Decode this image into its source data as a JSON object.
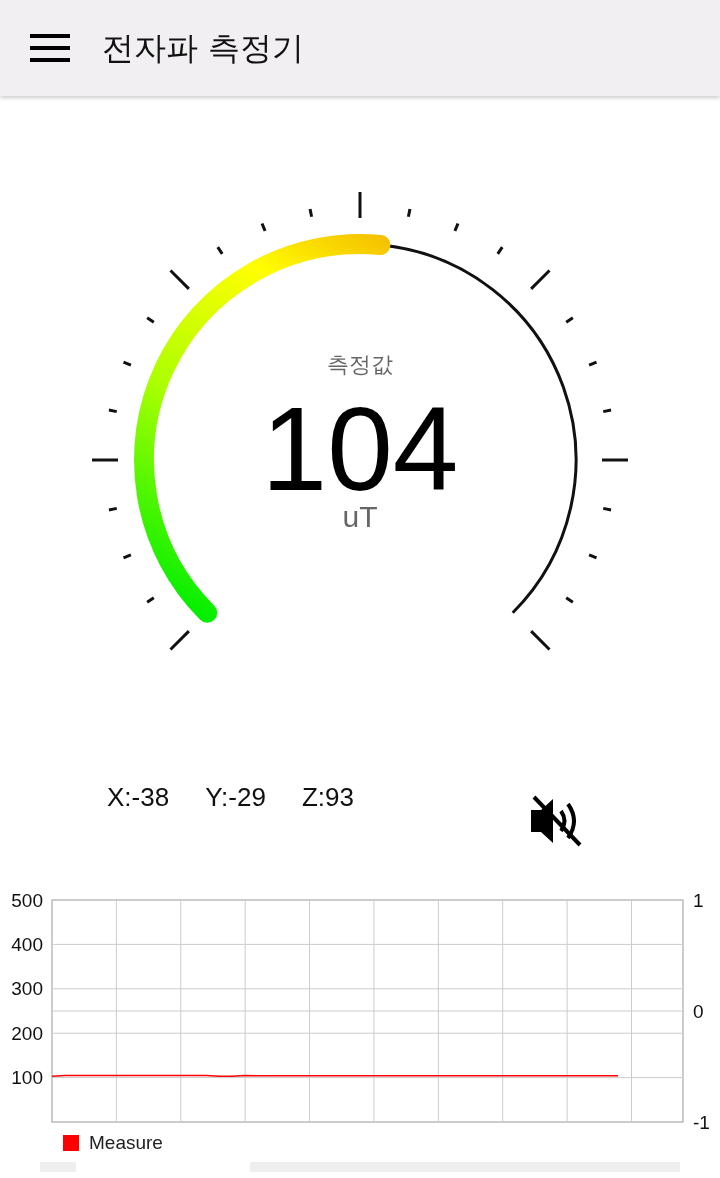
{
  "app_bar": {
    "title": "전자파 측정기"
  },
  "gauge": {
    "label": "측정값",
    "reading": "104",
    "unit": "uT"
  },
  "axes_readings": [
    "X:-38",
    "Y:-29",
    "Z:93"
  ],
  "sound": {
    "muted": true
  },
  "chart": {
    "right_axis_labels": [
      "1",
      "0",
      "-1"
    ],
    "chart_data": {
      "type": "line",
      "categories": [
        null,
        null,
        null,
        null,
        null,
        null,
        null,
        null,
        null,
        null,
        null,
        null,
        null,
        null,
        null,
        null,
        null,
        null,
        null,
        null,
        null,
        null,
        null,
        null,
        null,
        null,
        null,
        null,
        null,
        null,
        null,
        null,
        null,
        null,
        null,
        null,
        null,
        null,
        null,
        null,
        null,
        null,
        null,
        null,
        null
      ],
      "grid": true,
      "ylim": [
        0,
        500
      ],
      "yticks": [
        100,
        200,
        300,
        400,
        500
      ],
      "series": [
        {
          "name": "Measure",
          "color": "#ff0000",
          "values": [
            103,
            105,
            105,
            105,
            105,
            105,
            105,
            105,
            105,
            105,
            105,
            105,
            105,
            103,
            103,
            105,
            104,
            104,
            104,
            104,
            104,
            104,
            104,
            104,
            104,
            104,
            104,
            104,
            104,
            104,
            104,
            104,
            104,
            104,
            104,
            104,
            104,
            104,
            104,
            104,
            104,
            104,
            104,
            104,
            104
          ]
        }
      ]
    }
  }
}
